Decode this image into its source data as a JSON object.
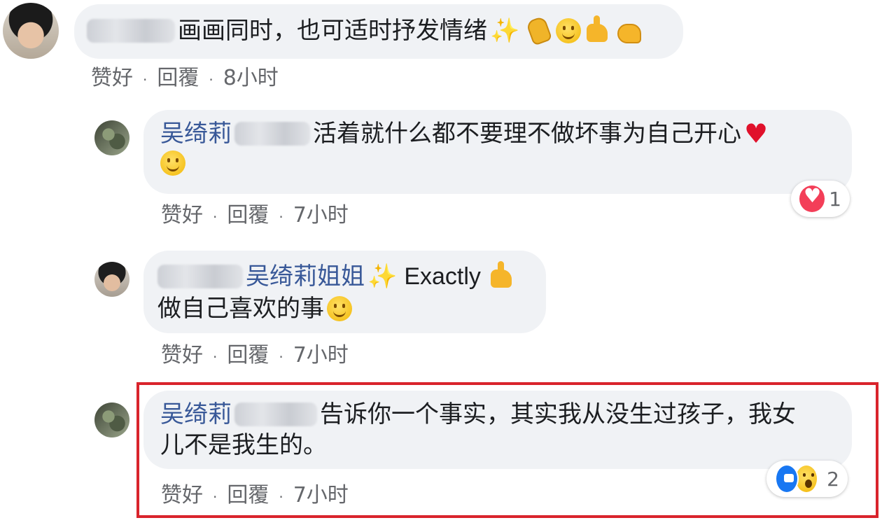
{
  "comments": [
    {
      "text": "画画同时，也可适时抒发情绪",
      "emojis": [
        "sparkles-icon",
        "clap-icon",
        "smile-icon",
        "thumbs-up-icon",
        "muscle-icon"
      ],
      "actions": {
        "like": "赞好",
        "reply": "回覆",
        "time": "8小时"
      }
    },
    {
      "author": "吴绮莉",
      "text": "活着就什么都不要理不做坏事为自己开心",
      "emojis": [
        "heart-icon",
        "grin-icon"
      ],
      "reaction_count": "1",
      "actions": {
        "like": "赞好",
        "reply": "回覆",
        "time": "7小时"
      }
    },
    {
      "mention": "吴绮莉姐姐",
      "text_1": "Exactly",
      "text_2": "做自己喜欢的事",
      "emojis": [
        "sparkles-icon",
        "thumbs-up-icon",
        "blush-icon"
      ],
      "actions": {
        "like": "赞好",
        "reply": "回覆",
        "time": "7小时"
      }
    },
    {
      "author": "吴绮莉",
      "text_1": "告诉你一个事实，其实我从没生过孩子，我女",
      "text_2": "儿不是我生的。",
      "reaction_count": "2",
      "actions": {
        "like": "赞好",
        "reply": "回覆",
        "time": "7小时"
      }
    }
  ],
  "separator": "·",
  "colors": {
    "name": "#385898",
    "bubble": "#f0f2f5",
    "highlight": "#d9242c",
    "meta": "#65676b"
  }
}
